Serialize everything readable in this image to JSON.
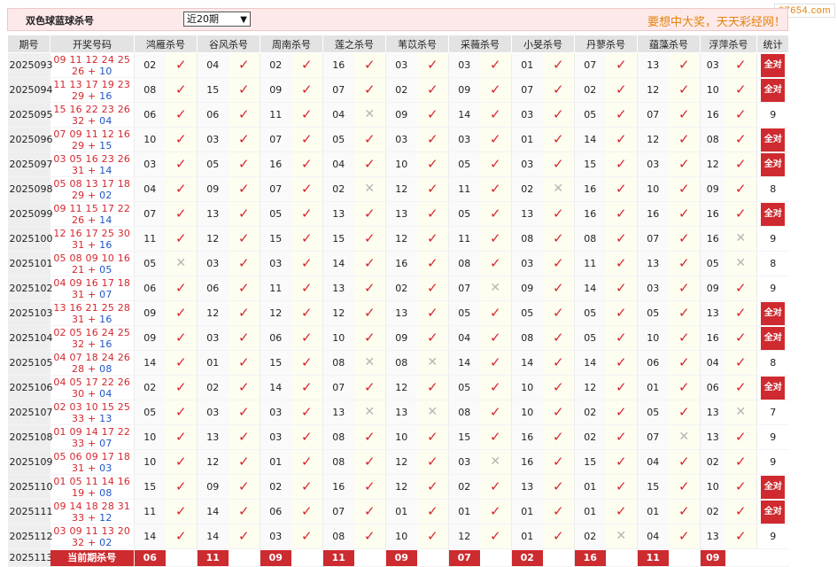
{
  "watermark": "97654.com",
  "header": {
    "title": "双色球蓝球杀号",
    "period_select": "近20期",
    "slogan": "要想中大奖，天天彩经网！"
  },
  "columns": [
    "期号",
    "开奖号码",
    "鸿雁杀号",
    "谷风杀号",
    "周南杀号",
    "莲之杀号",
    "苇苡杀号",
    "采薇杀号",
    "小旻杀号",
    "丹蓼杀号",
    "蕴藻杀号",
    "浮萍杀号",
    "统计"
  ],
  "all_correct_label": "全对",
  "rows": [
    {
      "issue": "2025093",
      "red": "09 11 12 24 25",
      "red2": "26",
      "blue": "10",
      "kills": [
        "02",
        "04",
        "02",
        "16",
        "03",
        "03",
        "01",
        "07",
        "13",
        "03"
      ],
      "hits": [
        1,
        1,
        1,
        1,
        1,
        1,
        1,
        1,
        1,
        1
      ],
      "count": ""
    },
    {
      "issue": "2025094",
      "red": "11 13 17 19 23",
      "red2": "29",
      "blue": "16",
      "kills": [
        "08",
        "15",
        "09",
        "07",
        "02",
        "09",
        "07",
        "02",
        "12",
        "10"
      ],
      "hits": [
        1,
        1,
        1,
        1,
        1,
        1,
        1,
        1,
        1,
        1
      ],
      "count": ""
    },
    {
      "issue": "2025095",
      "red": "15 16 22 23 26",
      "red2": "32",
      "blue": "04",
      "kills": [
        "06",
        "06",
        "11",
        "04",
        "09",
        "14",
        "03",
        "05",
        "07",
        "16"
      ],
      "hits": [
        1,
        1,
        1,
        0,
        1,
        1,
        1,
        1,
        1,
        1
      ],
      "count": "9"
    },
    {
      "issue": "2025096",
      "red": "07 09 11 12 16",
      "red2": "29",
      "blue": "15",
      "kills": [
        "10",
        "03",
        "07",
        "05",
        "03",
        "03",
        "01",
        "14",
        "12",
        "08"
      ],
      "hits": [
        1,
        1,
        1,
        1,
        1,
        1,
        1,
        1,
        1,
        1
      ],
      "count": ""
    },
    {
      "issue": "2025097",
      "red": "03 05 16 23 26",
      "red2": "31",
      "blue": "14",
      "kills": [
        "03",
        "05",
        "16",
        "04",
        "10",
        "05",
        "03",
        "15",
        "03",
        "12"
      ],
      "hits": [
        1,
        1,
        1,
        1,
        1,
        1,
        1,
        1,
        1,
        1
      ],
      "count": ""
    },
    {
      "issue": "2025098",
      "red": "05 08 13 17 18",
      "red2": "29",
      "blue": "02",
      "kills": [
        "04",
        "09",
        "07",
        "02",
        "12",
        "11",
        "02",
        "16",
        "10",
        "09"
      ],
      "hits": [
        1,
        1,
        1,
        0,
        1,
        1,
        0,
        1,
        1,
        1
      ],
      "count": "8"
    },
    {
      "issue": "2025099",
      "red": "09 11 15 17 22",
      "red2": "26",
      "blue": "14",
      "kills": [
        "07",
        "13",
        "05",
        "13",
        "13",
        "05",
        "13",
        "16",
        "16",
        "16"
      ],
      "hits": [
        1,
        1,
        1,
        1,
        1,
        1,
        1,
        1,
        1,
        1
      ],
      "count": ""
    },
    {
      "issue": "2025100",
      "red": "12 16 17 25 30",
      "red2": "31",
      "blue": "16",
      "kills": [
        "11",
        "12",
        "15",
        "15",
        "12",
        "11",
        "08",
        "08",
        "07",
        "16"
      ],
      "hits": [
        1,
        1,
        1,
        1,
        1,
        1,
        1,
        1,
        1,
        0
      ],
      "count": "9"
    },
    {
      "issue": "2025101",
      "red": "05 08 09 10 16",
      "red2": "21",
      "blue": "05",
      "kills": [
        "05",
        "03",
        "03",
        "14",
        "16",
        "08",
        "03",
        "11",
        "13",
        "05"
      ],
      "hits": [
        0,
        1,
        1,
        1,
        1,
        1,
        1,
        1,
        1,
        0
      ],
      "count": "8"
    },
    {
      "issue": "2025102",
      "red": "04 09 16 17 18",
      "red2": "31",
      "blue": "07",
      "kills": [
        "06",
        "06",
        "11",
        "13",
        "02",
        "07",
        "09",
        "14",
        "03",
        "09"
      ],
      "hits": [
        1,
        1,
        1,
        1,
        1,
        0,
        1,
        1,
        1,
        1
      ],
      "count": "9"
    },
    {
      "issue": "2025103",
      "red": "13 16 21 25 28",
      "red2": "31",
      "blue": "16",
      "kills": [
        "09",
        "12",
        "12",
        "12",
        "13",
        "05",
        "05",
        "05",
        "05",
        "13"
      ],
      "hits": [
        1,
        1,
        1,
        1,
        1,
        1,
        1,
        1,
        1,
        1
      ],
      "count": ""
    },
    {
      "issue": "2025104",
      "red": "02 05 16 24 25",
      "red2": "32",
      "blue": "16",
      "kills": [
        "09",
        "03",
        "06",
        "10",
        "09",
        "04",
        "08",
        "05",
        "10",
        "16"
      ],
      "hits": [
        1,
        1,
        1,
        1,
        1,
        1,
        1,
        1,
        1,
        1
      ],
      "count": ""
    },
    {
      "issue": "2025105",
      "red": "04 07 18 24 26",
      "red2": "28",
      "blue": "08",
      "kills": [
        "14",
        "01",
        "15",
        "08",
        "08",
        "14",
        "14",
        "14",
        "06",
        "04"
      ],
      "hits": [
        1,
        1,
        1,
        0,
        0,
        1,
        1,
        1,
        1,
        1
      ],
      "count": "8"
    },
    {
      "issue": "2025106",
      "red": "04 05 17 22 26",
      "red2": "30",
      "blue": "04",
      "kills": [
        "02",
        "02",
        "14",
        "07",
        "12",
        "05",
        "10",
        "12",
        "01",
        "06"
      ],
      "hits": [
        1,
        1,
        1,
        1,
        1,
        1,
        1,
        1,
        1,
        1
      ],
      "count": ""
    },
    {
      "issue": "2025107",
      "red": "02 03 10 15 25",
      "red2": "33",
      "blue": "13",
      "kills": [
        "05",
        "03",
        "03",
        "13",
        "13",
        "08",
        "10",
        "02",
        "05",
        "13"
      ],
      "hits": [
        1,
        1,
        1,
        0,
        0,
        1,
        1,
        1,
        1,
        0
      ],
      "count": "7"
    },
    {
      "issue": "2025108",
      "red": "01 09 14 17 22",
      "red2": "33",
      "blue": "07",
      "kills": [
        "10",
        "13",
        "03",
        "08",
        "10",
        "15",
        "16",
        "02",
        "07",
        "13"
      ],
      "hits": [
        1,
        1,
        1,
        1,
        1,
        1,
        1,
        1,
        0,
        1
      ],
      "count": "9"
    },
    {
      "issue": "2025109",
      "red": "05 06 09 17 18",
      "red2": "31",
      "blue": "03",
      "kills": [
        "10",
        "12",
        "01",
        "08",
        "12",
        "03",
        "16",
        "15",
        "04",
        "02"
      ],
      "hits": [
        1,
        1,
        1,
        1,
        1,
        0,
        1,
        1,
        1,
        1
      ],
      "count": "9"
    },
    {
      "issue": "2025110",
      "red": "01 05 11 14 16",
      "red2": "19",
      "blue": "08",
      "kills": [
        "15",
        "09",
        "02",
        "16",
        "12",
        "02",
        "13",
        "01",
        "15",
        "10"
      ],
      "hits": [
        1,
        1,
        1,
        1,
        1,
        1,
        1,
        1,
        1,
        1
      ],
      "count": ""
    },
    {
      "issue": "2025111",
      "red": "09 14 18 28 31",
      "red2": "33",
      "blue": "12",
      "kills": [
        "11",
        "14",
        "06",
        "07",
        "01",
        "01",
        "01",
        "01",
        "01",
        "02"
      ],
      "hits": [
        1,
        1,
        1,
        1,
        1,
        1,
        1,
        1,
        1,
        1
      ],
      "count": ""
    },
    {
      "issue": "2025112",
      "red": "03 09 11 13 20",
      "red2": "32",
      "blue": "02",
      "kills": [
        "14",
        "14",
        "03",
        "08",
        "10",
        "12",
        "01",
        "02",
        "04",
        "13"
      ],
      "hits": [
        1,
        1,
        1,
        1,
        1,
        1,
        1,
        0,
        1,
        1
      ],
      "count": "9"
    }
  ],
  "current": {
    "issue": "2025113",
    "label": "当前期杀号",
    "kills": [
      "06",
      "11",
      "09",
      "11",
      "09",
      "07",
      "02",
      "16",
      "11",
      "09"
    ]
  }
}
